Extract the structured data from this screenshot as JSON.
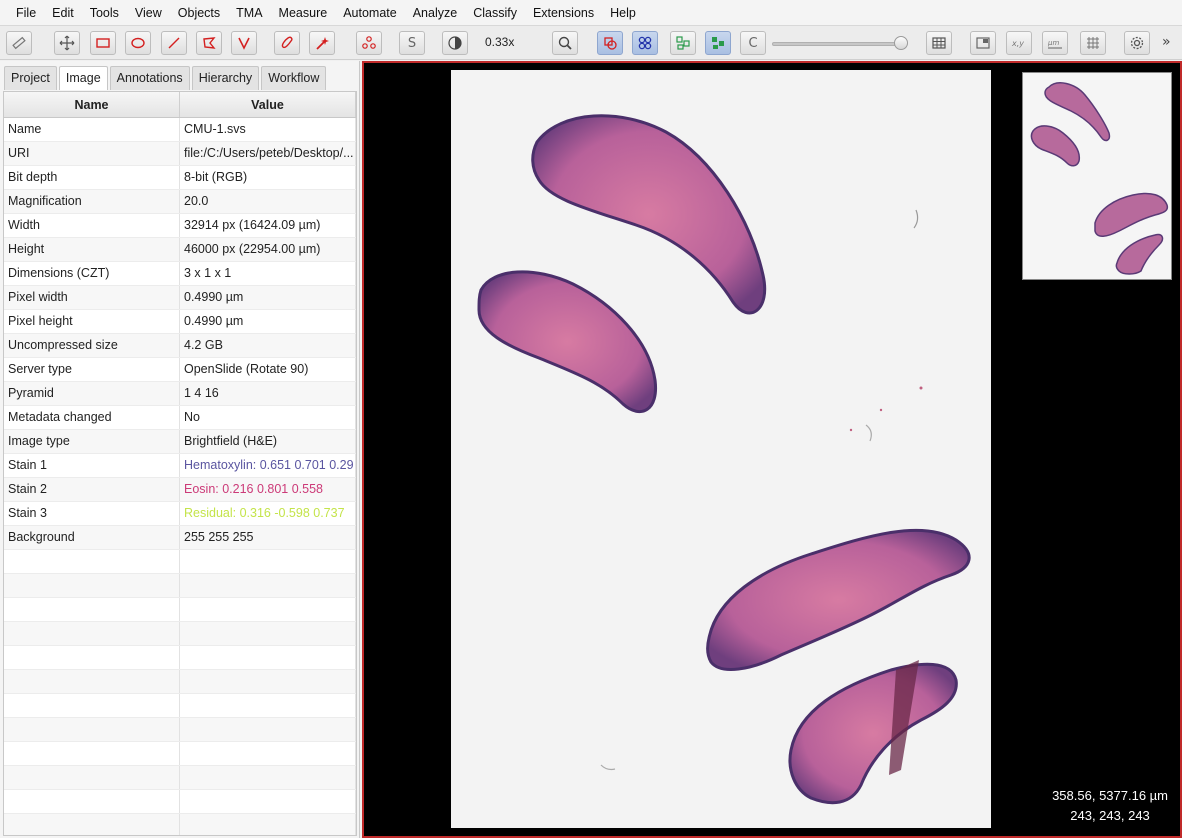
{
  "menu": [
    "File",
    "Edit",
    "Tools",
    "View",
    "Objects",
    "TMA",
    "Measure",
    "Automate",
    "Analyze",
    "Classify",
    "Extensions",
    "Help"
  ],
  "toolbar": {
    "zoom": "0.33x",
    "icons": [
      "ruler-icon",
      "move-icon",
      "rectangle-icon",
      "ellipse-icon",
      "line-icon",
      "polygon-icon",
      "polyline-icon",
      "brush-icon",
      "wand-icon",
      "points-icon",
      "selection-mode-icon",
      "contrast-icon",
      "zoom-to-fit-icon",
      "show-annotations-icon",
      "show-tma-grid-icon",
      "show-detections-icon",
      "fill-detections-icon",
      "show-cells-icon",
      "measurements-table-icon",
      "overview-icon",
      "coordinates-icon",
      "scalebar-icon",
      "grid-icon",
      "settings-icon"
    ]
  },
  "tabs": [
    "Project",
    "Image",
    "Annotations",
    "Hierarchy",
    "Workflow"
  ],
  "selected_tab": "Image",
  "table": {
    "headers": [
      "Name",
      "Value"
    ],
    "rows": [
      {
        "name": "Name",
        "value": "CMU-1.svs"
      },
      {
        "name": "URI",
        "value": "file:/C:/Users/peteb/Desktop/..."
      },
      {
        "name": "Bit depth",
        "value": "8-bit (RGB)"
      },
      {
        "name": "Magnification",
        "value": "20.0"
      },
      {
        "name": "Width",
        "value": "32914 px (16424.09 µm)"
      },
      {
        "name": "Height",
        "value": "46000 px (22954.00 µm)"
      },
      {
        "name": "Dimensions (CZT)",
        "value": "3 x 1 x 1"
      },
      {
        "name": "Pixel width",
        "value": "0.4990 µm"
      },
      {
        "name": "Pixel height",
        "value": "0.4990 µm"
      },
      {
        "name": "Uncompressed size",
        "value": "4.2 GB"
      },
      {
        "name": "Server type",
        "value": "OpenSlide (Rotate 90)"
      },
      {
        "name": "Pyramid",
        "value": "1 4 16"
      },
      {
        "name": "Metadata changed",
        "value": "No"
      },
      {
        "name": "Image type",
        "value": "Brightfield (H&E)"
      },
      {
        "name": "Stain 1",
        "value": "Hematoxylin: 0.651 0.701 0.29",
        "color": "#5a55a0"
      },
      {
        "name": "Stain 2",
        "value": "Eosin: 0.216 0.801 0.558",
        "color": "#cc3a78"
      },
      {
        "name": "Stain 3",
        "value": "Residual: 0.316 -0.598 0.737",
        "color": "#c4e44a"
      },
      {
        "name": "Background",
        "value": "255 255 255"
      }
    ],
    "empty_rows": 12
  },
  "viewer": {
    "cursor_um": "358.56, 5377.16 µm",
    "cursor_rgb": "243, 243, 243"
  },
  "colors": {
    "accent_border": "#c02a2a",
    "tissue_purple": "#9b4d8f",
    "tissue_pink": "#d26a9a"
  }
}
